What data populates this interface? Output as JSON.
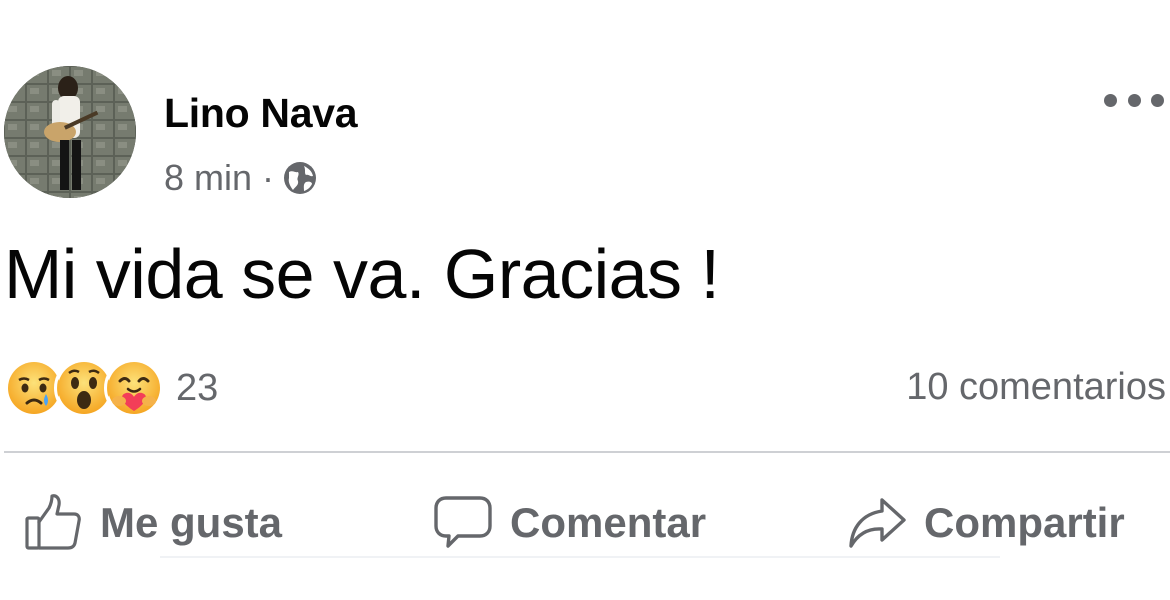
{
  "post": {
    "author": "Lino Nava",
    "time": "8 min",
    "separator": "·",
    "privacy_icon": "globe-icon",
    "message": "Mi vida se va. Gracias !",
    "reactions": {
      "icons": [
        "sad-reaction-icon",
        "wow-reaction-icon",
        "care-reaction-icon"
      ],
      "count": "23"
    },
    "comments_label": "10 comentarios"
  },
  "actions": {
    "like_label": "Me gusta",
    "comment_label": "Comentar",
    "share_label": "Compartir"
  },
  "colors": {
    "text_primary": "#050505",
    "text_secondary": "#65676b",
    "divider": "#ced0d4",
    "reaction_yellow": "#f7b125"
  }
}
